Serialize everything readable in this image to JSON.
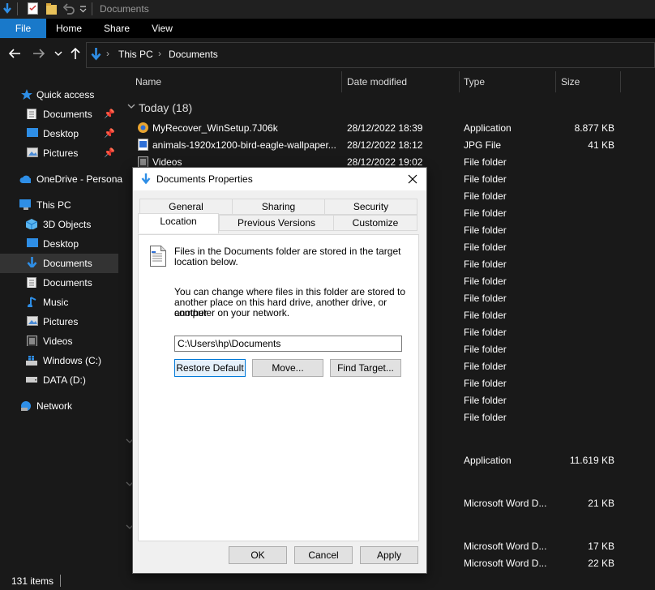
{
  "window": {
    "title": "Documents"
  },
  "ribbon": {
    "tabs": [
      "File",
      "Home",
      "Share",
      "View"
    ]
  },
  "address": {
    "crumbs": [
      "This PC",
      "Documents"
    ]
  },
  "nav": {
    "quick_access": "Quick access",
    "quick_items": [
      "Documents",
      "Desktop",
      "Pictures"
    ],
    "onedrive": "OneDrive - Persona",
    "this_pc": "This PC",
    "pc_items": [
      "3D Objects",
      "Desktop",
      "Documents",
      "Documents",
      "Music",
      "Pictures",
      "Videos",
      "Windows (C:)",
      "DATA (D:)"
    ],
    "network": "Network"
  },
  "columns": {
    "name": "Name",
    "date": "Date modified",
    "type": "Type",
    "size": "Size"
  },
  "group": {
    "label": "Today (18)"
  },
  "files": [
    {
      "name": "MyRecover_WinSetup.7J06k",
      "date": "28/12/2022 18:39",
      "type": "Application",
      "size": "8.877 KB"
    },
    {
      "name": "animals-1920x1200-bird-eagle-wallpaper...",
      "date": "28/12/2022 18:12",
      "type": "JPG File",
      "size": "41 KB"
    },
    {
      "name": "Videos",
      "date": "28/12/2022 19:02",
      "type": "File folder",
      "size": ""
    }
  ],
  "folder_type": "File folder",
  "lower_rows": [
    {
      "type": "Application",
      "size": "11.619 KB"
    },
    {
      "type": "Microsoft Word D...",
      "size": "21 KB"
    },
    {
      "type": "Microsoft Word D...",
      "size": "17 KB"
    },
    {
      "type": "Microsoft Word D...",
      "size": "22 KB"
    }
  ],
  "status": {
    "count": "131 items"
  },
  "dialog": {
    "title": "Documents Properties",
    "tabs_row1": [
      "General",
      "Sharing",
      "Security"
    ],
    "tabs_row2": [
      "Location",
      "Previous Versions",
      "Customize"
    ],
    "info_line1": "Files in the Documents folder are stored in the target",
    "info_line2": "location below.",
    "change_line1": "You can change where files in this folder are stored to",
    "change_line2": "another place on this hard drive, another drive, or another",
    "change_line3": "computer on your network.",
    "path": "C:\\Users\\hp\\Documents",
    "restore": "Restore Default",
    "move": "Move...",
    "find": "Find Target...",
    "ok": "OK",
    "cancel": "Cancel",
    "apply": "Apply"
  },
  "colors": {
    "accent": "#1979ca",
    "folder": "#e8c15a",
    "bg": "#191919"
  }
}
